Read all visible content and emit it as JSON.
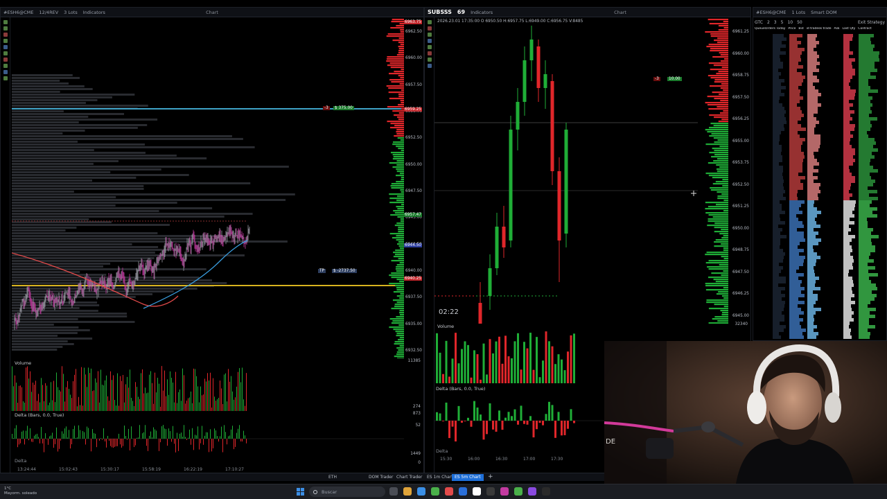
{
  "left_chart": {
    "toolbar": {
      "symbol": "#ESH6@CME",
      "bars": "12/4REV",
      "lots": "3 Lots",
      "indicators": "Indicators",
      "title": "Chart"
    },
    "prices": [
      "6962.50",
      "6960.00",
      "6957.50",
      "6955.00",
      "6952.50",
      "6950.00",
      "6947.50",
      "6945.00",
      "6942.50",
      "6940.00",
      "6937.50",
      "6935.00",
      "6932.50"
    ],
    "highlight_labels": [
      "6963.75",
      "6959.25",
      "6957.47",
      "6944.50",
      "6940.25"
    ],
    "position_tag": "-3",
    "pnl_tag": "$ 375.00",
    "tp_tag": "TP",
    "tp_value": "$ -2737.50",
    "volume_label": "Volume",
    "volume_value": "11385",
    "delta_label": "Delta (Bars, 0.0, True)",
    "delta_values": [
      "274",
      "873",
      "52",
      "1449",
      "0"
    ],
    "delta_footer": "Delta",
    "times": [
      "13:24:44",
      "15:02:43",
      "15:30:17",
      "15:58:19",
      "16:22:19",
      "17:10:27"
    ]
  },
  "mid_chart": {
    "toolbar": {
      "badge": "SUBSSS",
      "badge_count": "69",
      "indicators": "Indicators",
      "title": "Chart"
    },
    "header": "2026.23.01 17:35:00 O 6950.50 H:6957.75 L:6949.00 C:6956.75 V:8485",
    "prices": [
      "6961.25",
      "6960.00",
      "6958.75",
      "6957.50",
      "6956.25",
      "6955.00",
      "6953.75",
      "6952.50",
      "6951.25",
      "6950.00",
      "6948.75",
      "6947.50",
      "6946.25",
      "6945.00"
    ],
    "order_qty": "-3",
    "order_price": "10.00",
    "timer": "02:22",
    "volume_label": "Volume",
    "volume_value": "32340",
    "delta_label": "Delta (Bars, 0.0, True)",
    "delta_footer": "Delta",
    "times": [
      "15:30",
      "16:00",
      "16:30",
      "17:00",
      "17:30"
    ]
  },
  "dom": {
    "toolbar": {
      "symbol": "#ESH6@CME",
      "lots": "1 Lots",
      "title": "Smart DOM",
      "strategy": "Exit Strategy"
    },
    "preset": "GTC",
    "qty_buttons": [
      "2",
      "3",
      "5",
      "10",
      "50"
    ],
    "columns": [
      "QueueOrders Today",
      "Price",
      "Bid",
      "id tradesk trade",
      "Ask",
      "Last Qty",
      "Contract"
    ]
  },
  "tabs": {
    "items": [
      "ETH",
      "DOM Trader",
      "Chart Trader",
      "ES 1m Chart",
      "ES 5m Chart"
    ],
    "active": "ES 5m Chart",
    "add": "+"
  },
  "taskbar": {
    "weather_temp": "1°C",
    "weather_text": "Mayorm. soleado",
    "search_placeholder": "Buscar"
  },
  "colors": {
    "up": "#1fae37",
    "down": "#e0262a",
    "ma_red": "#e24a4a",
    "ma_blue": "#3a9ee0",
    "level_yellow": "#d7b21e",
    "level_cyan": "#3fa3c7",
    "accent_tab": "#1e6fd9"
  }
}
